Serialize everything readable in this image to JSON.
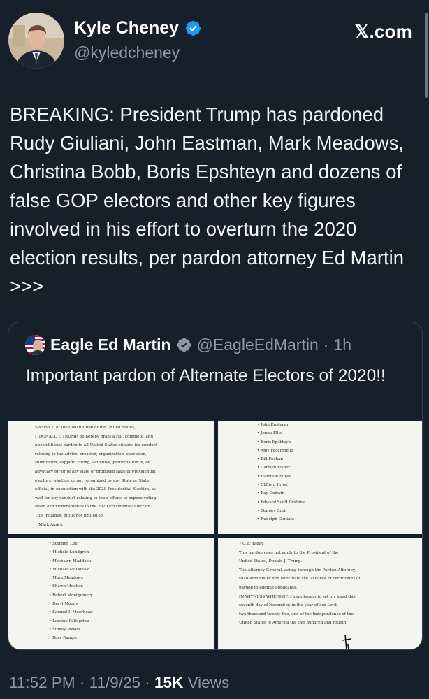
{
  "author": {
    "name": "Kyle Cheney",
    "handle": "@kyledcheney"
  },
  "brand": "𝕏.com",
  "tweet": {
    "text": "BREAKING: President Trump has pardoned Rudy Giuliani, John Eastman, Mark Meadows, Christina Bobb, Boris Epshteyn and dozens of false GOP electors and other key figures involved in his effort to overturn the 2020 election results, per pardon attorney Ed Martin >>>"
  },
  "quote": {
    "name": "Eagle Ed Martin",
    "handle": "@EagleEdMartin",
    "separator": "·",
    "time": "1h",
    "text": "Important pardon of Alternate Electors of 2020!!",
    "doc1": [
      "Section 2, of the Constitution of the United States,",
      "I, DONALD J. TRUMP, do hereby grant a full, complete, and",
      "unconditional pardon to all United States citizens for conduct",
      "relating to the advice, creation, organization, execution,",
      "submission, support, voting, activities, participation in, or",
      "advocacy for or of any slate or proposed slate of Presidential",
      "electors, whether or not recognized by any State or State",
      "official, in connection with the 2020 Presidential Election, as",
      "well for any conduct relating to their efforts to expose voting",
      "fraud and vulnerabilities in the 2020 Presidential Election.",
      "      This includes, but is not limited to:",
      "         •   Mark Amick"
    ],
    "doc2": [
      "•   John Eastman",
      "•   Jenna Ellis",
      "•   Boris Epshteyn",
      "•   Amy Facchinello",
      "•   Bill Feehan",
      "•   Carolyn Fisher",
      "•   Harrison Floyd",
      "•   Clifford Frost",
      "•   Kay Godwin",
      "•   Edward Scott Grabins",
      "•   Stanley Grot",
      "•   Rudolph Giuliani"
    ],
    "doc3": [
      "•   Stephen Lee",
      "•   Michele Lundgren",
      "•   Meshawn Maddock",
      "•   Michael McDonald",
      "•   Mark Meadows",
      "•   Shawn Meehan",
      "•   Robert Montgomery",
      "•   Daryl Moody",
      "•   Samuel I. Moorhead",
      "•   Loraine Pellegrino",
      "•   Sidney Powell",
      "•   Ross Rampe"
    ],
    "doc4": [
      "        •   C.B. Yadav",
      "      This pardon does not apply to the President of the",
      "United States, Donald J. Trump.",
      "      The Attorney General, acting through the Pardon Attorney,",
      "shall administer and effectuate the issuance of certificates of",
      "pardon to eligible applicants.",
      "      IN WITNESS WHEREOF, I have hereunto set my hand this",
      "seventh day of November, in the year of our Lord",
      "two thousand twenty-five, and of the Independence of the",
      "United States of America the two hundred and fiftieth."
    ]
  },
  "footer": {
    "time": "11:52 PM",
    "sep1": " · ",
    "date": "11/9/25",
    "sep2": " · ",
    "views_count": "15K",
    "views_label": " Views"
  }
}
